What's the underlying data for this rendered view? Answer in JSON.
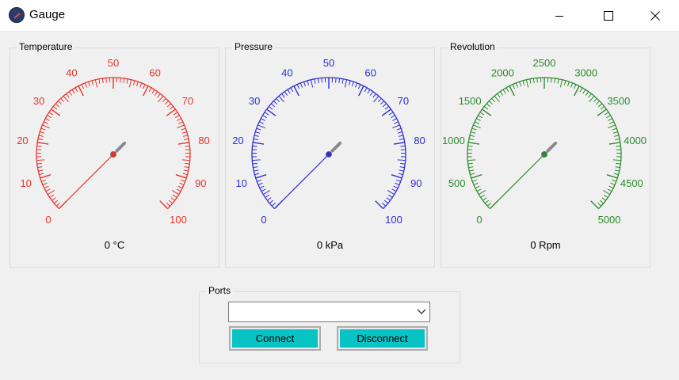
{
  "window": {
    "title": "Gauge",
    "controls": [
      "minimize-icon",
      "maximize-icon",
      "close-icon"
    ]
  },
  "gauges": [
    {
      "label": "Temperature",
      "color": "#e8332a",
      "min": 0,
      "max": 100,
      "ticks": [
        "0",
        "10",
        "20",
        "30",
        "40",
        "50",
        "60",
        "70",
        "80",
        "90",
        "100"
      ],
      "value": 0,
      "readout": "0 °C"
    },
    {
      "label": "Pressure",
      "color": "#2e2ed6",
      "min": 0,
      "max": 100,
      "ticks": [
        "0",
        "10",
        "20",
        "30",
        "40",
        "50",
        "60",
        "70",
        "80",
        "90",
        "100"
      ],
      "value": 0,
      "readout": "0 kPa"
    },
    {
      "label": "Revolution",
      "color": "#2e8b2e",
      "min": 0,
      "max": 5000,
      "ticks": [
        "0",
        "500",
        "1000",
        "1500",
        "2000",
        "2500",
        "3000",
        "3500",
        "4000",
        "4500",
        "5000"
      ],
      "value": 0,
      "readout": "0 Rpm"
    }
  ],
  "ports": {
    "label": "Ports",
    "selected": "",
    "connect_label": "Connect",
    "disconnect_label": "Disconnect",
    "button_color": "#08c3c3"
  }
}
